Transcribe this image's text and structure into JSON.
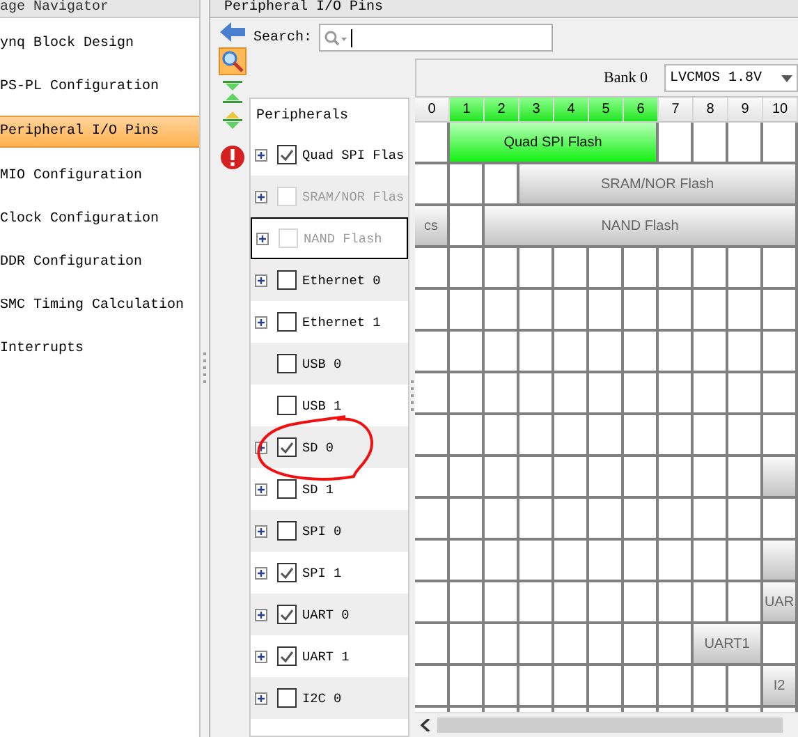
{
  "navigator": {
    "title": "age Navigator",
    "items": [
      {
        "label": "ynq Block Design",
        "selected": false
      },
      {
        "label": "PS-PL Configuration",
        "selected": false
      },
      {
        "label": "Peripheral I/O Pins",
        "selected": true
      },
      {
        "label": "MIO Configuration",
        "selected": false
      },
      {
        "label": "Clock Configuration",
        "selected": false
      },
      {
        "label": "DDR Configuration",
        "selected": false
      },
      {
        "label": "SMC Timing Calculation",
        "selected": false
      },
      {
        "label": "Interrupts",
        "selected": false
      }
    ]
  },
  "pins_panel": {
    "title": "Peripheral I/O Pins",
    "search": {
      "label": "Search:"
    },
    "bank": {
      "label": "Bank 0",
      "io_standard": "LVCMOS 1.8V"
    },
    "peripherals": {
      "header": "Peripherals",
      "items": [
        {
          "label": "Quad SPI Flas",
          "checked": true,
          "disabled": false,
          "expandable": true,
          "focused": false
        },
        {
          "label": "SRAM/NOR Flas",
          "checked": false,
          "disabled": true,
          "expandable": true,
          "focused": false
        },
        {
          "label": "NAND Flash",
          "checked": false,
          "disabled": true,
          "expandable": true,
          "focused": true
        },
        {
          "label": "Ethernet 0",
          "checked": false,
          "disabled": false,
          "expandable": true,
          "focused": false
        },
        {
          "label": "Ethernet 1",
          "checked": false,
          "disabled": false,
          "expandable": true,
          "focused": false
        },
        {
          "label": "USB 0",
          "checked": false,
          "disabled": false,
          "expandable": false,
          "focused": false
        },
        {
          "label": "USB 1",
          "checked": false,
          "disabled": false,
          "expandable": false,
          "focused": false
        },
        {
          "label": "SD 0",
          "checked": true,
          "disabled": false,
          "expandable": true,
          "focused": false
        },
        {
          "label": "SD 1",
          "checked": false,
          "disabled": false,
          "expandable": true,
          "focused": false
        },
        {
          "label": "SPI 0",
          "checked": false,
          "disabled": false,
          "expandable": true,
          "focused": false
        },
        {
          "label": "SPI 1",
          "checked": true,
          "disabled": false,
          "expandable": true,
          "focused": false
        },
        {
          "label": "UART 0",
          "checked": true,
          "disabled": false,
          "expandable": true,
          "focused": false
        },
        {
          "label": "UART 1",
          "checked": true,
          "disabled": false,
          "expandable": true,
          "focused": false
        },
        {
          "label": "I2C 0",
          "checked": false,
          "disabled": false,
          "expandable": true,
          "focused": false
        }
      ]
    },
    "pin_grid": {
      "columns": [
        {
          "label": "0",
          "assigned": false
        },
        {
          "label": "1",
          "assigned": true
        },
        {
          "label": "2",
          "assigned": true
        },
        {
          "label": "3",
          "assigned": true
        },
        {
          "label": "4",
          "assigned": true
        },
        {
          "label": "5",
          "assigned": true
        },
        {
          "label": "6",
          "assigned": true
        },
        {
          "label": "7",
          "assigned": false
        },
        {
          "label": "8",
          "assigned": false
        },
        {
          "label": "9",
          "assigned": false
        },
        {
          "label": "10",
          "assigned": false
        }
      ],
      "rows": [
        {
          "cells": [
            {
              "kind": "free"
            },
            {
              "kind": "assigned",
              "label": "Quad SPI Flash"
            },
            {
              "kind": "joined"
            },
            {
              "kind": "joined"
            },
            {
              "kind": "joined"
            },
            {
              "kind": "joined"
            },
            {
              "kind": "joined"
            },
            {
              "kind": "free"
            },
            {
              "kind": "free"
            },
            {
              "kind": "free"
            },
            {
              "kind": "free"
            }
          ]
        },
        {
          "cells": [
            {
              "kind": "free"
            },
            {
              "kind": "free"
            },
            {
              "kind": "free"
            },
            {
              "kind": "available",
              "label": "SRAM/NOR Flash"
            },
            {
              "kind": "joined"
            },
            {
              "kind": "joined"
            },
            {
              "kind": "joined"
            },
            {
              "kind": "joined"
            },
            {
              "kind": "joined"
            },
            {
              "kind": "joined"
            },
            {
              "kind": "joined"
            }
          ]
        },
        {
          "cells": [
            {
              "kind": "available",
              "label": "cs"
            },
            {
              "kind": "free"
            },
            {
              "kind": "available",
              "label": "NAND Flash"
            },
            {
              "kind": "joined"
            },
            {
              "kind": "joined"
            },
            {
              "kind": "joined"
            },
            {
              "kind": "joined"
            },
            {
              "kind": "joined"
            },
            {
              "kind": "joined"
            },
            {
              "kind": "joined"
            },
            {
              "kind": "joined"
            }
          ]
        },
        {},
        {},
        {},
        {},
        {},
        {
          "cells": [
            {
              "kind": "free"
            },
            {
              "kind": "free"
            },
            {
              "kind": "free"
            },
            {
              "kind": "free"
            },
            {
              "kind": "free"
            },
            {
              "kind": "free"
            },
            {
              "kind": "free"
            },
            {
              "kind": "free"
            },
            {
              "kind": "free"
            },
            {
              "kind": "free"
            },
            {
              "kind": "available"
            }
          ]
        },
        {},
        {
          "cells": [
            {
              "kind": "free"
            },
            {
              "kind": "free"
            },
            {
              "kind": "free"
            },
            {
              "kind": "free"
            },
            {
              "kind": "free"
            },
            {
              "kind": "free"
            },
            {
              "kind": "free"
            },
            {
              "kind": "free"
            },
            {
              "kind": "free"
            },
            {
              "kind": "free"
            },
            {
              "kind": "available"
            }
          ]
        },
        {
          "cells": [
            {
              "kind": "free"
            },
            {
              "kind": "free"
            },
            {
              "kind": "free"
            },
            {
              "kind": "free"
            },
            {
              "kind": "free"
            },
            {
              "kind": "free"
            },
            {
              "kind": "free"
            },
            {
              "kind": "free"
            },
            {
              "kind": "free"
            },
            {
              "kind": "free"
            },
            {
              "kind": "available",
              "label": "UAR"
            }
          ]
        },
        {
          "cells": [
            {
              "kind": "free"
            },
            {
              "kind": "free"
            },
            {
              "kind": "free"
            },
            {
              "kind": "free"
            },
            {
              "kind": "free"
            },
            {
              "kind": "free"
            },
            {
              "kind": "free"
            },
            {
              "kind": "free"
            },
            {
              "kind": "available",
              "label": "UART1"
            },
            {
              "kind": "joined"
            },
            {
              "kind": "free"
            }
          ]
        },
        {
          "cells": [
            {
              "kind": "free"
            },
            {
              "kind": "free"
            },
            {
              "kind": "free"
            },
            {
              "kind": "free"
            },
            {
              "kind": "free"
            },
            {
              "kind": "free"
            },
            {
              "kind": "free"
            },
            {
              "kind": "free"
            },
            {
              "kind": "free"
            },
            {
              "kind": "free"
            },
            {
              "kind": "available",
              "label": "I2"
            }
          ]
        },
        {}
      ]
    }
  }
}
